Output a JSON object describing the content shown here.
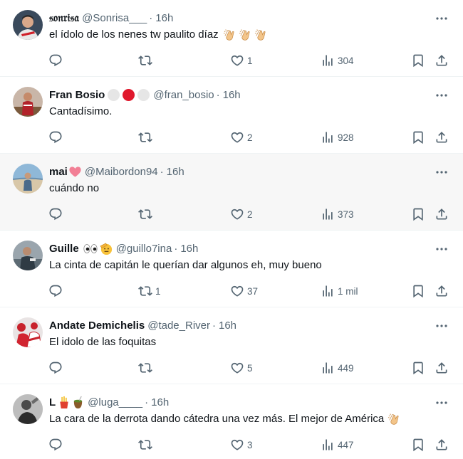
{
  "tweets": [
    {
      "display_name": "𝔰𝔬𝔫𝔯𝔦𝔰𝔞",
      "handle": "@Sonrisa___",
      "separator": "·",
      "time": "16h",
      "text": "el ídolo de los nenes tw paulito díaz",
      "text_emoji": [
        "clapping-hands",
        "clapping-hands",
        "clapping-hands"
      ],
      "name_badges": [],
      "replies": "",
      "retweets": "",
      "likes": "1",
      "views": "304"
    },
    {
      "display_name": "Fran Bosio",
      "handle": "@fran_bosio",
      "separator": "·",
      "time": "16h",
      "text": "Cantadísimo.",
      "text_emoji": [],
      "name_badges": [
        "white-circle",
        "red-circle",
        "white-circle"
      ],
      "replies": "",
      "retweets": "",
      "likes": "2",
      "views": "928"
    },
    {
      "display_name": "mai",
      "handle": "@Maibordon94",
      "separator": "·",
      "time": "16h",
      "text": "cuándo no",
      "text_emoji": [],
      "name_badges": [
        "pink-heart"
      ],
      "replies": "",
      "retweets": "",
      "likes": "2",
      "views": "373"
    },
    {
      "display_name": "Guille",
      "handle": "@guillo7ina",
      "separator": "·",
      "time": "16h",
      "text": "La cinta de capitán le querían dar algunos eh, muy bueno",
      "text_emoji": [],
      "name_badges": [
        "eyes",
        "saluting-face"
      ],
      "replies": "",
      "retweets": "1",
      "likes": "37",
      "views": "1 mil"
    },
    {
      "display_name": "Andate Demichelis",
      "handle": "@tade_River",
      "separator": "·",
      "time": "16h",
      "text": "El idolo de las foquitas",
      "text_emoji": [],
      "name_badges": [],
      "replies": "",
      "retweets": "",
      "likes": "5",
      "views": "449"
    },
    {
      "display_name": "L",
      "handle": "@luga____",
      "separator": "·",
      "time": "16h",
      "text": "La cara de la derrota dando cátedra una vez más. El mejor de América",
      "text_emoji": [
        "clapping-hands"
      ],
      "name_badges": [
        "fries",
        "mate"
      ],
      "replies": "",
      "retweets": "",
      "likes": "3",
      "views": "447"
    }
  ],
  "colors": {
    "text": "#0f1419",
    "secondary": "#536471",
    "divider": "#eff3f4",
    "hover_bg": "#f7f7f7",
    "clap": "#f3c58a",
    "heart": "#f27f95",
    "red_badge": "#e0192d",
    "white_badge": "#e6e6e6"
  }
}
